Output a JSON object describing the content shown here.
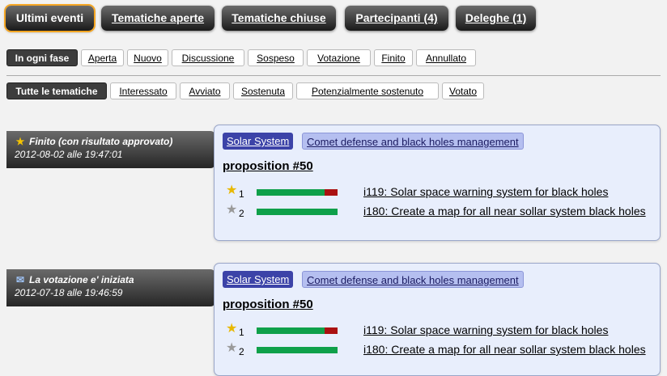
{
  "top_tabs": [
    {
      "label": "Ultimi eventi",
      "active": true
    },
    {
      "label": "Tematiche aperte",
      "active": false
    },
    {
      "label": "Tematiche chiuse",
      "active": false
    },
    {
      "label": "Partecipanti (4)",
      "active": false
    },
    {
      "label": "Deleghe (1)",
      "active": false
    }
  ],
  "phase_filters": [
    {
      "label": "In ogni fase",
      "active": true
    },
    {
      "label": "Aperta",
      "active": false
    },
    {
      "label": "Nuovo",
      "active": false
    },
    {
      "label": "Discussione",
      "active": false
    },
    {
      "label": "Sospeso",
      "active": false
    },
    {
      "label": "Votazione",
      "active": false
    },
    {
      "label": "Finito",
      "active": false
    },
    {
      "label": "Annullato",
      "active": false
    }
  ],
  "interest_filters": [
    {
      "label": "Tutte le tematiche",
      "active": true
    },
    {
      "label": "Interessato",
      "active": false
    },
    {
      "label": "Avviato",
      "active": false
    },
    {
      "label": "Sostenuta",
      "active": false
    },
    {
      "label": "Potenzialmente sostenuto",
      "active": false
    },
    {
      "label": "Votato",
      "active": false
    }
  ],
  "events": [
    {
      "icon": "star-icon",
      "title": "Finito (con risultato approvato)",
      "timestamp": "2012-08-02 alle 19:47:01",
      "area": "Solar System",
      "policy": "Comet defense and black holes management",
      "proposition": "proposition #50",
      "initiatives": [
        {
          "rank": "1",
          "winner": true,
          "support": 0.84,
          "against": 0.16,
          "label": "i119: Solar space warning system for black holes"
        },
        {
          "rank": "2",
          "winner": false,
          "support": 1.0,
          "against": 0.0,
          "label": "i180: Create a map for all near sollar system black holes"
        }
      ]
    },
    {
      "icon": "ballot-icon",
      "title": "La votazione e' iniziata",
      "timestamp": "2012-07-18 alle 19:46:59",
      "area": "Solar System",
      "policy": "Comet defense and black holes management",
      "proposition": "proposition #50",
      "initiatives": [
        {
          "rank": "1",
          "winner": true,
          "support": 0.84,
          "against": 0.16,
          "label": "i119: Solar space warning system for black holes"
        },
        {
          "rank": "2",
          "winner": false,
          "support": 1.0,
          "against": 0.0,
          "label": "i180: Create a map for all near sollar system black holes"
        }
      ]
    }
  ],
  "colors": {
    "accent": "#f5a623",
    "support": "#0fa04a",
    "against": "#aa1111",
    "area_tag": "#3c43a8",
    "policy_tag": "#b5bff0"
  }
}
